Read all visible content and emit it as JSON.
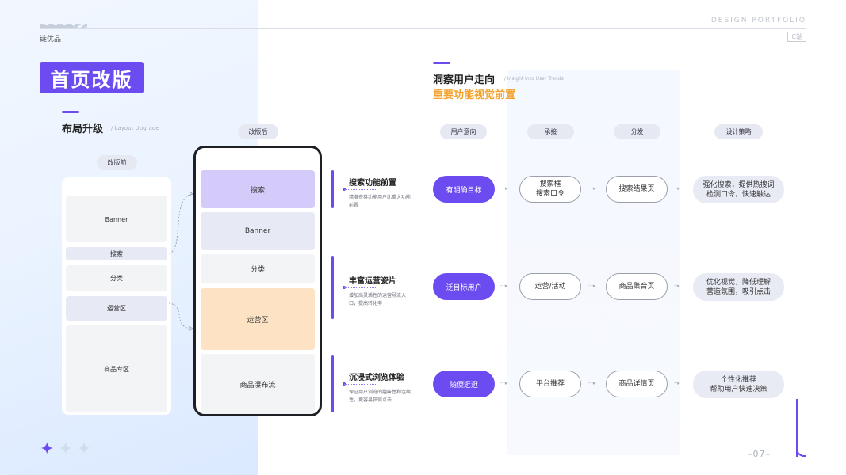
{
  "header": {
    "brand": "链优品",
    "portfolio": "DESIGN PORTFOLIO",
    "badge": "C端"
  },
  "title": "首页改版",
  "layout_section": {
    "title": "布局升级",
    "subtitle": "/ Layout Upgrade"
  },
  "before": {
    "label": "改版前",
    "blocks": [
      "Banner",
      "搜索",
      "分类",
      "运营区",
      "商品专区"
    ]
  },
  "after": {
    "label": "改版后",
    "blocks": [
      "搜索",
      "Banner",
      "分类",
      "运营区",
      "商品瀑布流"
    ]
  },
  "features": [
    {
      "title": "搜索功能前置",
      "desc": "精准查券功能用户比重大功能前置"
    },
    {
      "title": "丰富运营瓷片",
      "desc": "增加高灵活性的运营导流入口，提高转化率"
    },
    {
      "title": "沉浸式浏览体验",
      "desc": "保证用户浏览的趣味性和连续性，更容易获得点击"
    }
  ],
  "insight": {
    "title": "洞察用户走向",
    "subtitle": "/ Insight Into User Trends",
    "highlight": "重要功能视觉前置"
  },
  "columns": [
    "用户意向",
    "承接",
    "分发",
    "设计策略"
  ],
  "rows": [
    {
      "intent": "有明确目标",
      "carry": "搜索框\n搜索口令",
      "dist": "搜索结果页",
      "strategy": "强化搜索，提供热搜词\n检测口令，快速触达"
    },
    {
      "intent": "泛目标用户",
      "carry": "运营/活动",
      "dist": "商品聚合页",
      "strategy": "优化视觉，降低理解\n营造氛围，吸引点击"
    },
    {
      "intent": "随便逛逛",
      "carry": "平台推荐",
      "dist": "商品详情页",
      "strategy": "个性化推荐\n帮助用户快速决策"
    }
  ],
  "footer": {
    "page": "–07–"
  },
  "colors": {
    "accent": "#6c4cf0",
    "highlight": "#f4a22d",
    "search_block": "#d4cbfb",
    "banner_block": "#e7eaf5",
    "ops_block": "#fde3c4"
  },
  "icons": [
    "sparkle-icon",
    "sparkle-icon",
    "sparkle-icon"
  ]
}
